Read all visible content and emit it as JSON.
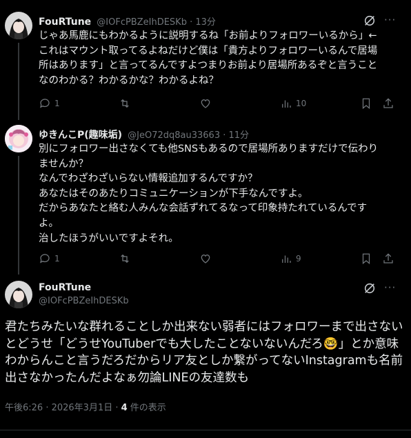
{
  "tweets": [
    {
      "name": "FouRTune",
      "handle": "@IOFcPBZeIhDESKb",
      "time": "13分",
      "text": "じゃあ馬鹿にもわかるように説明するね「お前よりフォロワーいるから」←\nこれはマウント取ってるよねだけど僕は「貴方よりフォロワーいるんで居場\n所はあります」と言ってるんですよつまりお前より居場所あるぞと言うこと\nなのわかる？わかるかな？わかるよね？",
      "replies": "1",
      "views": "10"
    },
    {
      "name": "ゆきんこP(趣味垢)",
      "handle": "@JeO72dq8au33663",
      "time": "11分",
      "text": "別にフォロワー出さなくても他SNSもあるので居場所ありますだけで伝わり\nませんか？\nなんでわざわざいらない情報追加するんですか？\nあなたはそのあたりコミュニケーションが下手なんですよ。\nだからあなたと絡む人みんな会話ずれてるなって印象持たれているんです\nよ。\n治したほうがいいですよそれ。",
      "replies": "1",
      "views": "9"
    }
  ],
  "main_tweet": {
    "name": "FouRTune",
    "handle": "@IOFcPBZeIhDESKb",
    "text_before_emoji": "君たちみたいな群れることしか出来ない弱者にはフォロワーまで出さない\nとどうせ「どうせYouTuberでも大したことないないんだろ",
    "emoji": "🤓",
    "text_after_emoji": "」とか意味\nわからんこと言うだろだからリア友としか繋がってないInstagramも名前\n出さなかったんだよなぁ勿論LINEの友達数も",
    "timestamp": "午後6:26 · 2026年3月1日 · ",
    "views_count": "4",
    "views_label": " 件の表示"
  },
  "icons": [
    "reply-icon",
    "retweet-icon",
    "like-icon",
    "views-icon",
    "bookmark-icon",
    "share-icon",
    "grok-icon",
    "more-icon"
  ],
  "colors": {
    "background": "#000000",
    "text": "#e7e9ea",
    "muted": "#71767b",
    "divider": "#2f3336"
  }
}
